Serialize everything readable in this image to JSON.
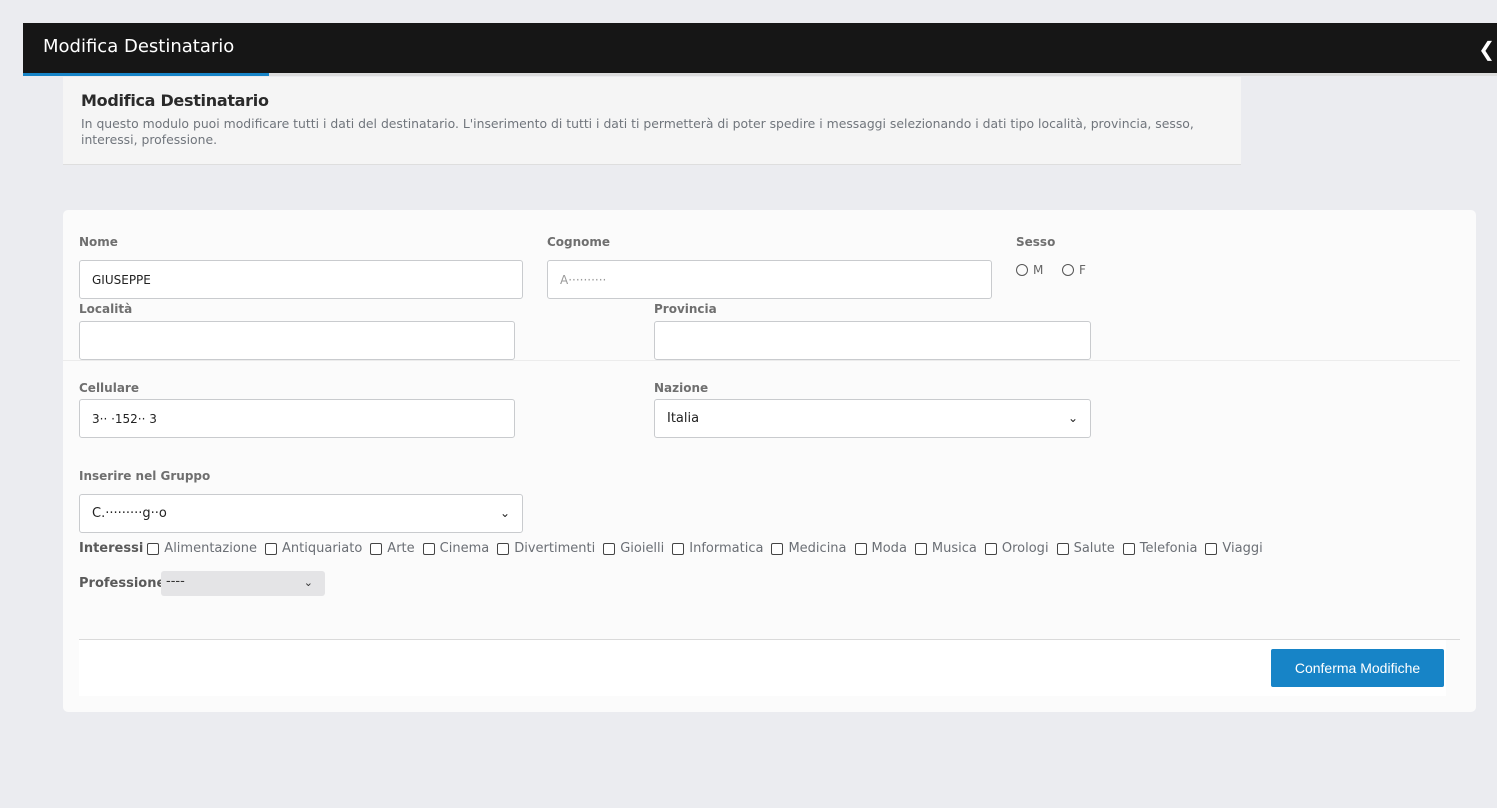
{
  "topbar": {
    "title": "Modifica Destinatario",
    "back_icon": "chevron-left-icon"
  },
  "intro": {
    "heading": "Modifica Destinatario",
    "description": "In questo modulo puoi modificare tutti i dati del destinatario. L'inserimento di tutti i dati ti permetterà di poter spedire i messaggi selezionando i dati tipo località, provincia, sesso, interessi, professione."
  },
  "form": {
    "nome": {
      "label": "Nome",
      "value": "GIUSEPPE"
    },
    "cognome": {
      "label": "Cognome",
      "value": "A··········"
    },
    "sesso": {
      "label": "Sesso",
      "options": [
        "M",
        "F"
      ]
    },
    "localita": {
      "label": "Località",
      "value": ""
    },
    "provincia": {
      "label": "Provincia",
      "value": ""
    },
    "cellulare": {
      "label": "Cellulare",
      "value": "3·· ·152·· 3"
    },
    "nazione": {
      "label": "Nazione",
      "value": "Italia"
    },
    "gruppo": {
      "label": "Inserire nel Gruppo",
      "value": "C.·········g··o"
    },
    "interessi": {
      "label": "Interessi",
      "options": [
        "Alimentazione",
        "Antiquariato",
        "Arte",
        "Cinema",
        "Divertimenti",
        "Gioielli",
        "Informatica",
        "Medicina",
        "Moda",
        "Musica",
        "Orologi",
        "Salute",
        "Telefonia",
        "Viaggi"
      ]
    },
    "professione": {
      "label": "Professione",
      "value": "----"
    },
    "submit_label": "Conferma Modifiche"
  }
}
